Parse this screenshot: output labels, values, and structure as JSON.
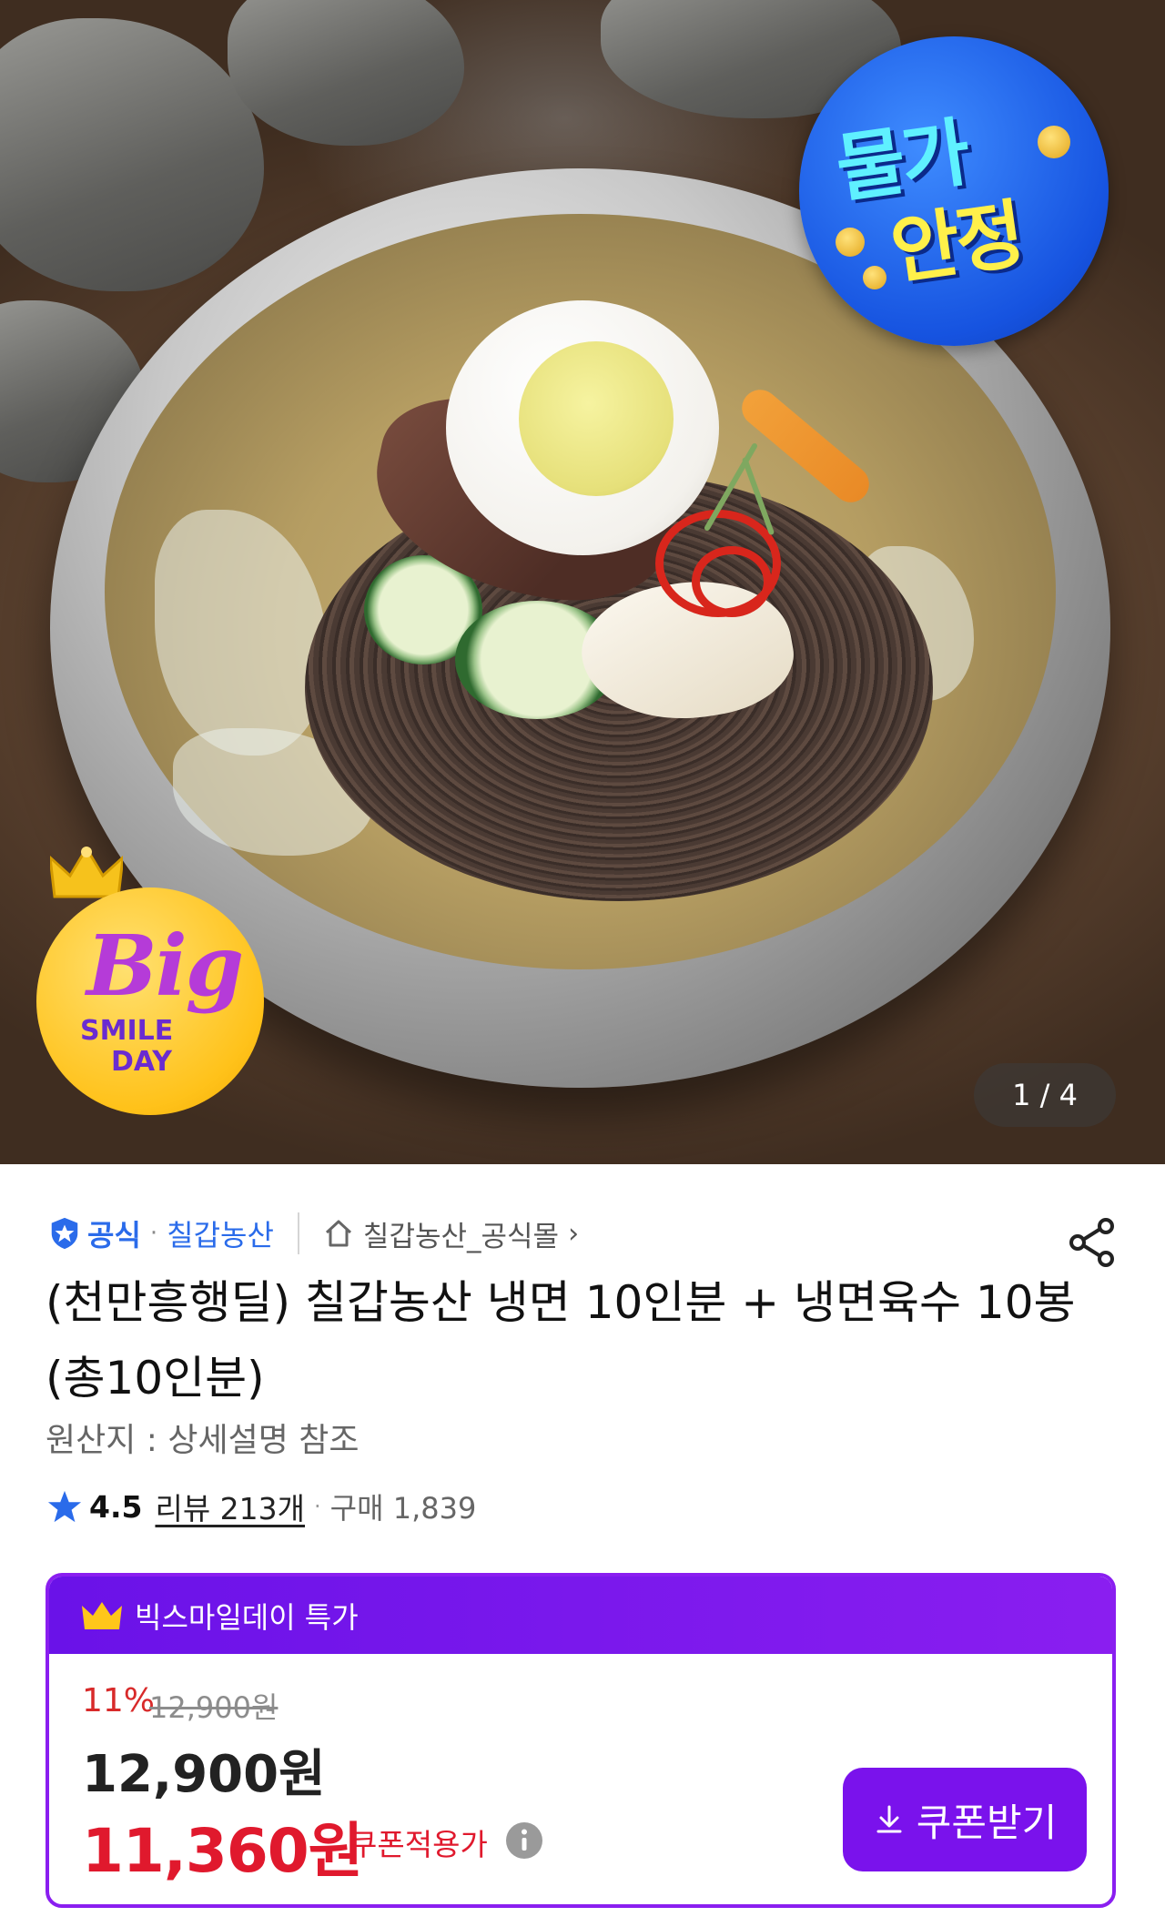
{
  "hero": {
    "badge_top": {
      "line1": "물가",
      "line2": "안정"
    },
    "badge_bottom": {
      "big": "Big",
      "smile": "SMILE",
      "day": "DAY"
    },
    "pager": "1 / 4"
  },
  "seller": {
    "official_label": "공식",
    "separator": "·",
    "brand": "칠갑농산",
    "store": "칠갑농산_공식몰",
    "store_chevron": "›"
  },
  "product": {
    "title": "(천만흥행딜) 칠갑농산 냉면 10인분 + 냉면육수 10봉 (총10인분)",
    "origin": "원산지 : 상세설명 참조"
  },
  "rating": {
    "score": "4.5",
    "reviews": "리뷰 213개",
    "separator": "·",
    "purchases": "구매 1,839"
  },
  "price_box": {
    "header": "빅스마일데이 특가",
    "discount": "11%",
    "original_price": "12,900원",
    "price": "12,900원",
    "coupon_price": "11,360원",
    "coupon_label": "쿠폰적용가",
    "coupon_button": "쿠폰받기"
  },
  "colors": {
    "accent_purple": "#7a12ec",
    "official_blue": "#2a6bea",
    "sale_red": "#e0192d"
  },
  "icons": [
    "official-shield-icon",
    "home-icon",
    "share-icon",
    "star-icon",
    "crown-icon",
    "info-icon",
    "download-icon"
  ]
}
